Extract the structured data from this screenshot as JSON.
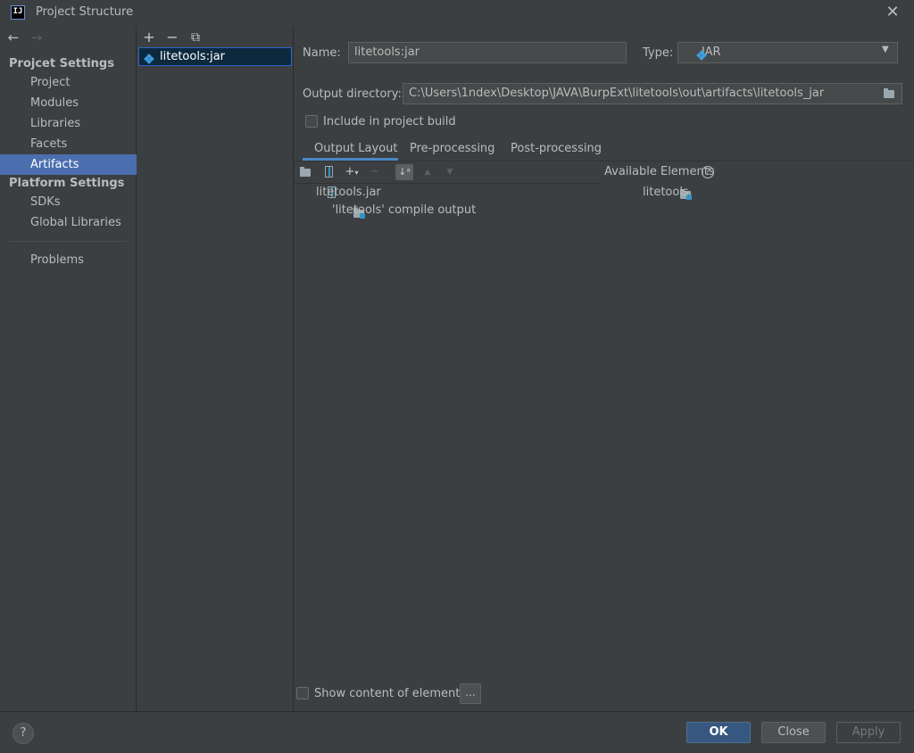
{
  "window": {
    "title": "Project Structure",
    "app_icon_text": "IJ"
  },
  "nav": {
    "back": "←",
    "forward": "→",
    "project_settings_header": "Projcet Settings",
    "platform_settings_header": "Platform Settings",
    "items_project": [
      "Project",
      "Modules",
      "Libraries",
      "Facets",
      "Artifacts"
    ],
    "items_platform": [
      "SDKs",
      "Global Libraries"
    ],
    "problems": "Problems",
    "selected": "Artifacts"
  },
  "artifacts": {
    "toolbar": [
      "+",
      "−",
      "⧉"
    ],
    "list": [
      "litetools:jar"
    ]
  },
  "detail": {
    "name_label": "Name:",
    "name_value": "litetools:jar",
    "type_label": "Type:",
    "type_value": "JAR",
    "output_dir_label": "Output directory:",
    "output_dir_value": "C:\\Users\\1ndex\\Desktop\\JAVA\\BurpExt\\litetools\\out\\artifacts\\litetools_jar",
    "include_label": "Include in project build",
    "include_checked": false,
    "tabs": [
      "Output Layout",
      "Pre-processing",
      "Post-processing"
    ],
    "active_tab": "Output Layout",
    "layout_tree": {
      "root": "litetools.jar",
      "child": "'litetools' compile output"
    },
    "available_label": "Available Elements",
    "available_items": [
      "litetools"
    ],
    "show_content_label": "Show content of elements",
    "dots": "..."
  },
  "footer": {
    "help": "?",
    "ok": "OK",
    "close": "Close",
    "apply": "Apply"
  },
  "colors": {
    "background": "#3c3f41",
    "selection": "#4b6eaf",
    "ok_button": "#365880",
    "accent_blue": "#3592c4"
  }
}
